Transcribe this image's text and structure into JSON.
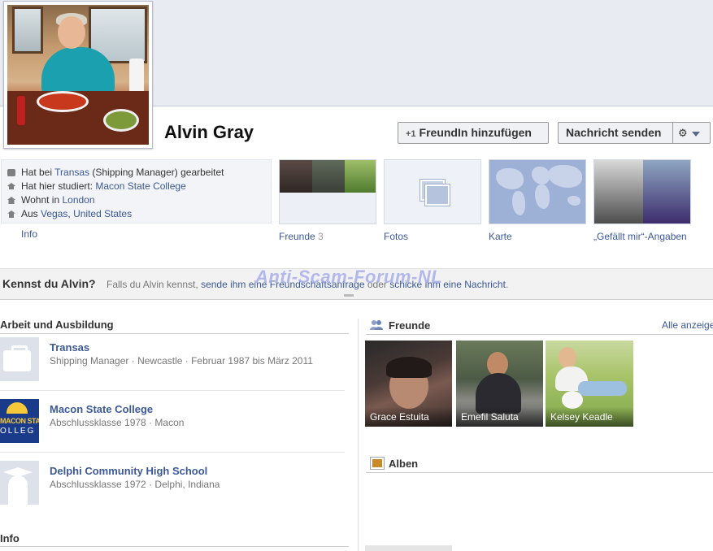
{
  "profile": {
    "name": "Alvin Gray"
  },
  "actions": {
    "add_friend_icon": "+1",
    "add_friend": "FreundIn hinzufügen",
    "send_message": "Nachricht senden",
    "settings_icon": "gear-icon"
  },
  "info": {
    "work_prefix": "Hat bei ",
    "work_employer": "Transas",
    "work_suffix": " (Shipping Manager) gearbeitet",
    "study_prefix": "Hat hier studiert: ",
    "study_school": "Macon State College",
    "lives_prefix": "Wohnt in ",
    "lives_city": "London",
    "from_prefix": "Aus ",
    "from_city": "Vegas",
    "from_sep": ", ",
    "from_country": "United States",
    "link": "Info"
  },
  "tiles": {
    "friends_label": "Freunde",
    "friends_count": "3",
    "photos_label": "Fotos",
    "map_label": "Karte",
    "likes_label": "„Gefällt mir“-Angaben"
  },
  "watermark": "Anti-Scam-Forum-NL",
  "know": {
    "title": "Kennst du Alvin?",
    "text_1": "Falls du Alvin kennst, ",
    "link_1": "sende ihm eine Freundschaftsanfrage",
    "text_2": " oder ",
    "link_2": "schicke ihm eine Nachricht",
    "text_3": "."
  },
  "work_section": {
    "title": "Arbeit und Ausbildung",
    "items": [
      {
        "name": "Transas",
        "sub": "Shipping Manager · Newcastle · Februar 1987 bis März 2011"
      },
      {
        "name": "Macon State College",
        "sub": "Abschlussklasse 1978 · Macon",
        "logo_top": "MACON STA",
        "logo_bottom": "OLLEG"
      },
      {
        "name": "Delphi Community High School",
        "sub": "Abschlussklasse 1972 · Delphi, Indiana"
      }
    ]
  },
  "info_section": {
    "title": "Info"
  },
  "friends_section": {
    "title": "Freunde",
    "see_all": "Alle anzeigen",
    "friends": [
      {
        "name": "Grace Estuita"
      },
      {
        "name": "Emefil Saluta"
      },
      {
        "name": "Kelsey Keadle"
      }
    ]
  },
  "albums_section": {
    "title": "Alben"
  }
}
